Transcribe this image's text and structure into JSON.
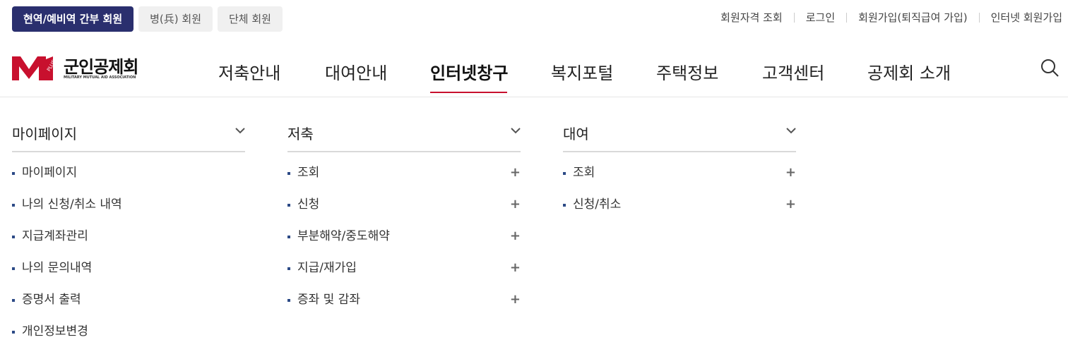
{
  "member_tabs": [
    {
      "label": "현역/예비역 간부 회원",
      "active": true
    },
    {
      "label": "병(兵) 회원",
      "active": false
    },
    {
      "label": "단체 회원",
      "active": false
    }
  ],
  "util_links": [
    "회원자격 조회",
    "로그인",
    "회원가입(퇴직급여 가입)",
    "인터넷 회원가입"
  ],
  "logo": {
    "text": "군인공제회",
    "sub": "MILITARY MUTUAL AID ASSOCIATION",
    "badge": "PLUS",
    "color": "#c8102e"
  },
  "gnb": [
    "저축안내",
    "대여안내",
    "인터넷창구",
    "복지포털",
    "주택정보",
    "고객센터",
    "공제회 소개"
  ],
  "gnb_active_index": 2,
  "menu": {
    "mypage": {
      "title": "마이페이지",
      "items": [
        "마이페이지",
        "나의 신청/취소 내역",
        "지급계좌관리",
        "나의 문의내역",
        "증명서 출력",
        "개인정보변경"
      ]
    },
    "saving": {
      "title": "저축",
      "items": [
        "조회",
        "신청",
        "부분해약/중도해약",
        "지급/재가입",
        "증좌 및 감좌"
      ]
    },
    "loan": {
      "title": "대여",
      "items": [
        "조회",
        "신청/취소"
      ]
    }
  },
  "colors": {
    "navy": "#2a2f6e",
    "accent": "#c8102e",
    "bullet": "#2c4a86"
  }
}
